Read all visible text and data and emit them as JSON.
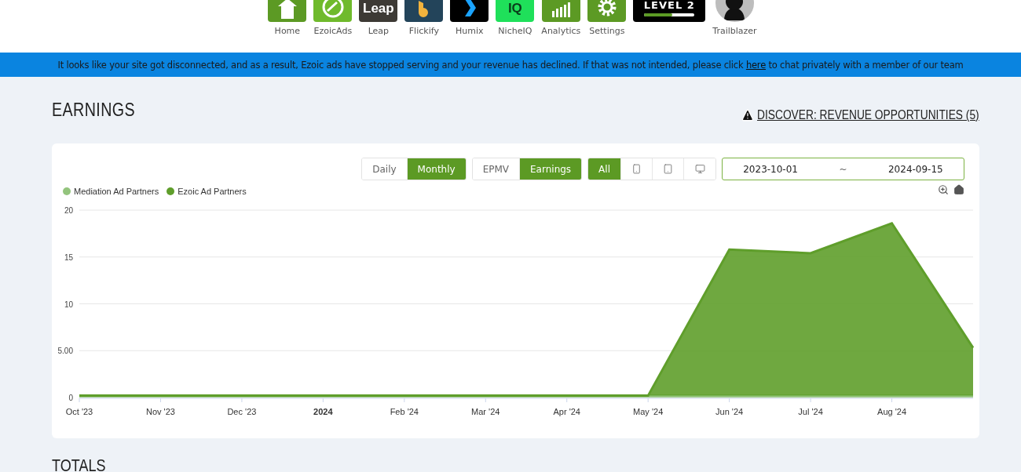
{
  "nav": {
    "items": [
      {
        "kind": "home",
        "label": "Home",
        "color": "#5c9a24"
      },
      {
        "kind": "ezoicads",
        "label": "EzoicAds",
        "color": "#6fba2c"
      },
      {
        "kind": "leap",
        "label": "Leap",
        "color": "#3d3a35",
        "logo_text": "Leap"
      },
      {
        "kind": "flickify",
        "label": "Flickify",
        "color": "#23445a"
      },
      {
        "kind": "humix",
        "label": "Humix",
        "color": "#000000"
      },
      {
        "kind": "nicheiq",
        "label": "NicheIQ",
        "color": "#1fe05a",
        "logo_text": "IQ"
      },
      {
        "kind": "analytics",
        "label": "Analytics",
        "color": "#5c9a24"
      },
      {
        "kind": "settings",
        "label": "Settings",
        "color": "#5c9a24"
      },
      {
        "kind": "level",
        "title": "LEVEL 2",
        "level": 0.55,
        "color": "#000000"
      },
      {
        "kind": "avatar",
        "label": "Trailblazer",
        "color": "#bdbdbd"
      }
    ]
  },
  "banner": {
    "before": "It looks like your site got disconnected, and as a result, Ezoic ads have stopped serving and your revenue has declined. If that was not intended, please click",
    "link": "here",
    "after": "to chat privately with a member of our team"
  },
  "earnings": {
    "title": "EARNINGS",
    "discover": "DISCOVER: REVENUE OPPORTUNITIES (5)",
    "period_tabs": [
      {
        "label": "Daily",
        "selected": false
      },
      {
        "label": "Monthly",
        "selected": true
      }
    ],
    "metric_tabs": [
      {
        "label": "EPMV",
        "selected": false
      },
      {
        "label": "Earnings",
        "selected": true
      }
    ],
    "device_tabs": [
      {
        "kind": "all",
        "label": "All",
        "selected": true
      },
      {
        "kind": "phone",
        "selected": false
      },
      {
        "kind": "tablet",
        "selected": false
      },
      {
        "kind": "desktop",
        "selected": false
      }
    ],
    "date_range": {
      "start": "2023-10-01",
      "separator": "~",
      "end": "2024-09-15"
    },
    "chart_data": {
      "type": "area",
      "stacked": true,
      "categories": [
        "Oct '23",
        "Nov '23",
        "Dec '23",
        "2024",
        "Feb '24",
        "Mar '24",
        "Apr '24",
        "May '24",
        "Jun '24",
        "Jul '24",
        "Aug '24",
        null
      ],
      "yticks": [
        {
          "value": 0,
          "label": "0"
        },
        {
          "value": 5,
          "label": "5.00"
        },
        {
          "value": 10,
          "label": "10"
        },
        {
          "value": 15,
          "label": "15"
        },
        {
          "value": 20,
          "label": "20"
        }
      ],
      "ylim": [
        0,
        20
      ],
      "grid": true,
      "series": [
        {
          "name": "Mediation Ad Partners",
          "color": "#93c47d",
          "values": [
            0.2,
            0.2,
            0.2,
            0.2,
            0.2,
            0.2,
            0.2,
            0.2,
            0.2,
            0.2,
            0.2,
            0.2
          ]
        },
        {
          "name": "Ezoic Ad Partners",
          "color": "#5f9e2b",
          "values": [
            0,
            0,
            0,
            0,
            0,
            0,
            0,
            0,
            15.6,
            15.2,
            18.4,
            5.1
          ]
        }
      ]
    }
  },
  "totals": {
    "title": "TOTALS"
  }
}
